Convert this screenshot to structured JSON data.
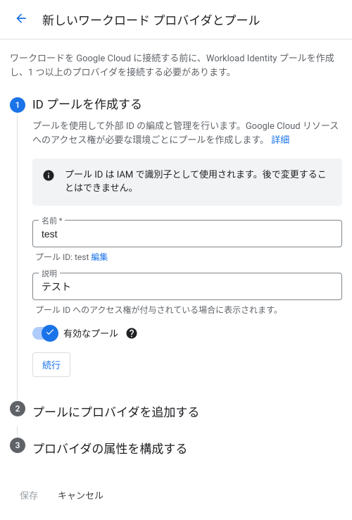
{
  "header": {
    "title": "新しいワークロード プロバイダとプール"
  },
  "intro": "ワークロードを Google Cloud に接続する前に、Workload Identity プールを作成し、1 つ以上のプロバイダを接続する必要があります。",
  "steps": {
    "s1": {
      "num": "1",
      "title": "ID プールを作成する",
      "desc": "プールを使用して外部 ID の編成と管理を行います。Google Cloud リソースへのアクセス権が必要な環境ごとにプールを作成します。",
      "details_link": "詳細",
      "info": "プール ID は IAM で識別子として使用されます。後で変更することはできません。",
      "name_label": "名前 *",
      "name_value": "test",
      "pool_id_prefix": "プール ID: test",
      "edit_link": "編集",
      "desc_label": "説明",
      "desc_value": "テスト",
      "desc_helper": "プール ID へのアクセス権が付与されている場合に表示されます。",
      "toggle_label": "有効なプール",
      "continue": "続行"
    },
    "s2": {
      "num": "2",
      "title": "プールにプロバイダを追加する"
    },
    "s3": {
      "num": "3",
      "title": "プロバイダの属性を構成する"
    }
  },
  "footer": {
    "save": "保存",
    "cancel": "キャンセル"
  }
}
